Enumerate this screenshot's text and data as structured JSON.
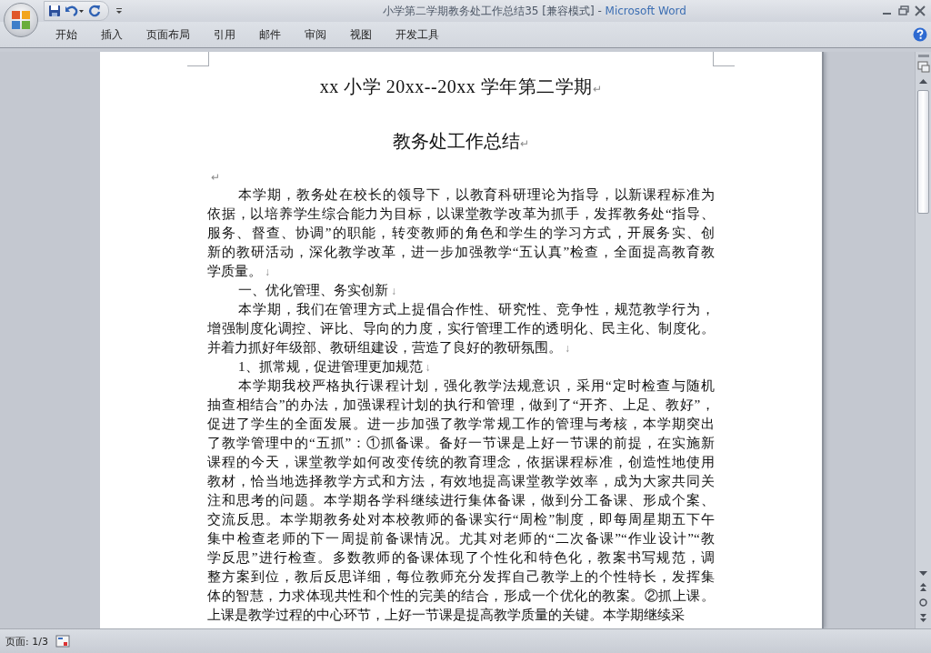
{
  "window": {
    "document_title": "小学第二学期教务处工作总结35 [兼容模式]",
    "separator": "-",
    "app_name": "Microsoft Word"
  },
  "ribbon_tabs": [
    {
      "label": "开始"
    },
    {
      "label": "插入"
    },
    {
      "label": "页面布局"
    },
    {
      "label": "引用"
    },
    {
      "label": "邮件"
    },
    {
      "label": "审阅"
    },
    {
      "label": "视图"
    },
    {
      "label": "开发工具"
    }
  ],
  "document": {
    "title": "xx 小学 20xx--20xx 学年第二学期",
    "title_mark": "↵",
    "subtitle": "教务处工作总结",
    "subtitle_mark": "↵",
    "body": [
      {
        "kind": "empty",
        "mark": "↵"
      },
      {
        "kind": "paragraph",
        "mark": "↓",
        "lines": [
          "本学期，教务处在校长的领导下，以教育科研理论为指导，以新课程标准为",
          "依据，以培养学生综合能力为目标，以课堂教学改革为抓手，发挥教务处“指导、",
          "服务、督查、协调”的职能，转变教师的角色和学生的学习方式，开展务实、创",
          "新的教研活动，深化教学改革，进一步加强教学“五认真”检查，全面提高教育教",
          "学质量。"
        ]
      },
      {
        "kind": "paragraph",
        "mark": "↓",
        "lines": [
          "一、优化管理、务实创新"
        ]
      },
      {
        "kind": "paragraph",
        "mark": "↓",
        "lines": [
          "本学期，我们在管理方式上提倡合作性、研究性、竞争性，规范教学行为，",
          "增强制度化调控、评比、导向的力度，实行管理工作的透明化、民主化、制度化。",
          "并着力抓好年级部、教研组建设，营造了良好的教研氛围。"
        ]
      },
      {
        "kind": "paragraph",
        "mark": "↓",
        "lines": [
          "1、抓常规，促进管理更加规范"
        ]
      },
      {
        "kind": "paragraph",
        "lines": [
          "本学期我校严格执行课程计划，强化教学法规意识，采用“定时检查与随机",
          "抽查相结合”的办法，加强课程计划的执行和管理，做到了“开齐、上足、教好”，",
          "促进了学生的全面发展。进一步加强了教学常规工作的管理与考核，本学期突出",
          "了教学管理中的“五抓”：①抓备课。备好一节课是上好一节课的前提，在实施新",
          "课程的今天，课堂教学如何改变传统的教育理念，依据课程标准，创造性地使用",
          "教材，恰当地选择教学方式和方法，有效地提高课堂教学效率，成为大家共同关",
          "注和思考的问题。本学期各学科继续进行集体备课，做到分工备课、形成个案、",
          "交流反思。本学期教务处对本校教师的备课实行“周检”制度，即每周星期五下午",
          "集中检查老师的下一周提前备课情况。尤其对老师的“二次备课”“作业设计”“教",
          "学反思”进行检查。多数教师的备课体现了个性化和特色化，教案书写规范，调",
          "整方案到位，教后反思详细，每位教师充分发挥自己教学上的个性特长，发挥集",
          "体的智慧，力求体现共性和个性的完美的结合，形成一个优化的教案。②抓上课。",
          "上课是教学过程的中心环节，上好一节课是提高教学质量的关键。本学期继续采"
        ]
      }
    ]
  },
  "status_bar": {
    "page": "页面: 1/3"
  }
}
